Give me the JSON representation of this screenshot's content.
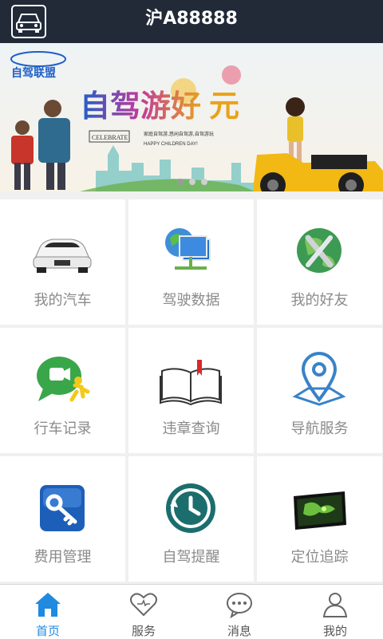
{
  "header": {
    "plate": "沪A88888"
  },
  "banner": {
    "logo_text": "自驾联盟",
    "headline": "自驾游好",
    "headline_alt": "元",
    "badge": "CELEBRATE",
    "slogan_small": "家庭自驾游,悠闲自驾游,自驾游玩",
    "tag": "HAPPY CHILDREN DAY!",
    "dots": 3,
    "active_dot": 0
  },
  "grid": {
    "tiles": [
      {
        "label": "我的汽车",
        "icon": "car-icon"
      },
      {
        "label": "驾驶数据",
        "icon": "network-data-icon"
      },
      {
        "label": "我的好友",
        "icon": "globe-tools-icon"
      },
      {
        "label": "行车记录",
        "icon": "video-runner-icon"
      },
      {
        "label": "违章查询",
        "icon": "book-icon"
      },
      {
        "label": "导航服务",
        "icon": "location-pin-icon"
      },
      {
        "label": "费用管理",
        "icon": "key-icon"
      },
      {
        "label": "自驾提醒",
        "icon": "clock-icon"
      },
      {
        "label": "定位追踪",
        "icon": "tracking-map-icon"
      }
    ]
  },
  "tabbar": {
    "tabs": [
      {
        "label": "首页",
        "icon": "home-icon",
        "active": true
      },
      {
        "label": "服务",
        "icon": "heart-icon",
        "active": false
      },
      {
        "label": "消息",
        "icon": "chat-icon",
        "active": false
      },
      {
        "label": "我的",
        "icon": "user-icon",
        "active": false
      }
    ]
  },
  "colors": {
    "topbar": "#222a38",
    "accent": "#1f8ae0",
    "label": "#8a8a8a"
  }
}
